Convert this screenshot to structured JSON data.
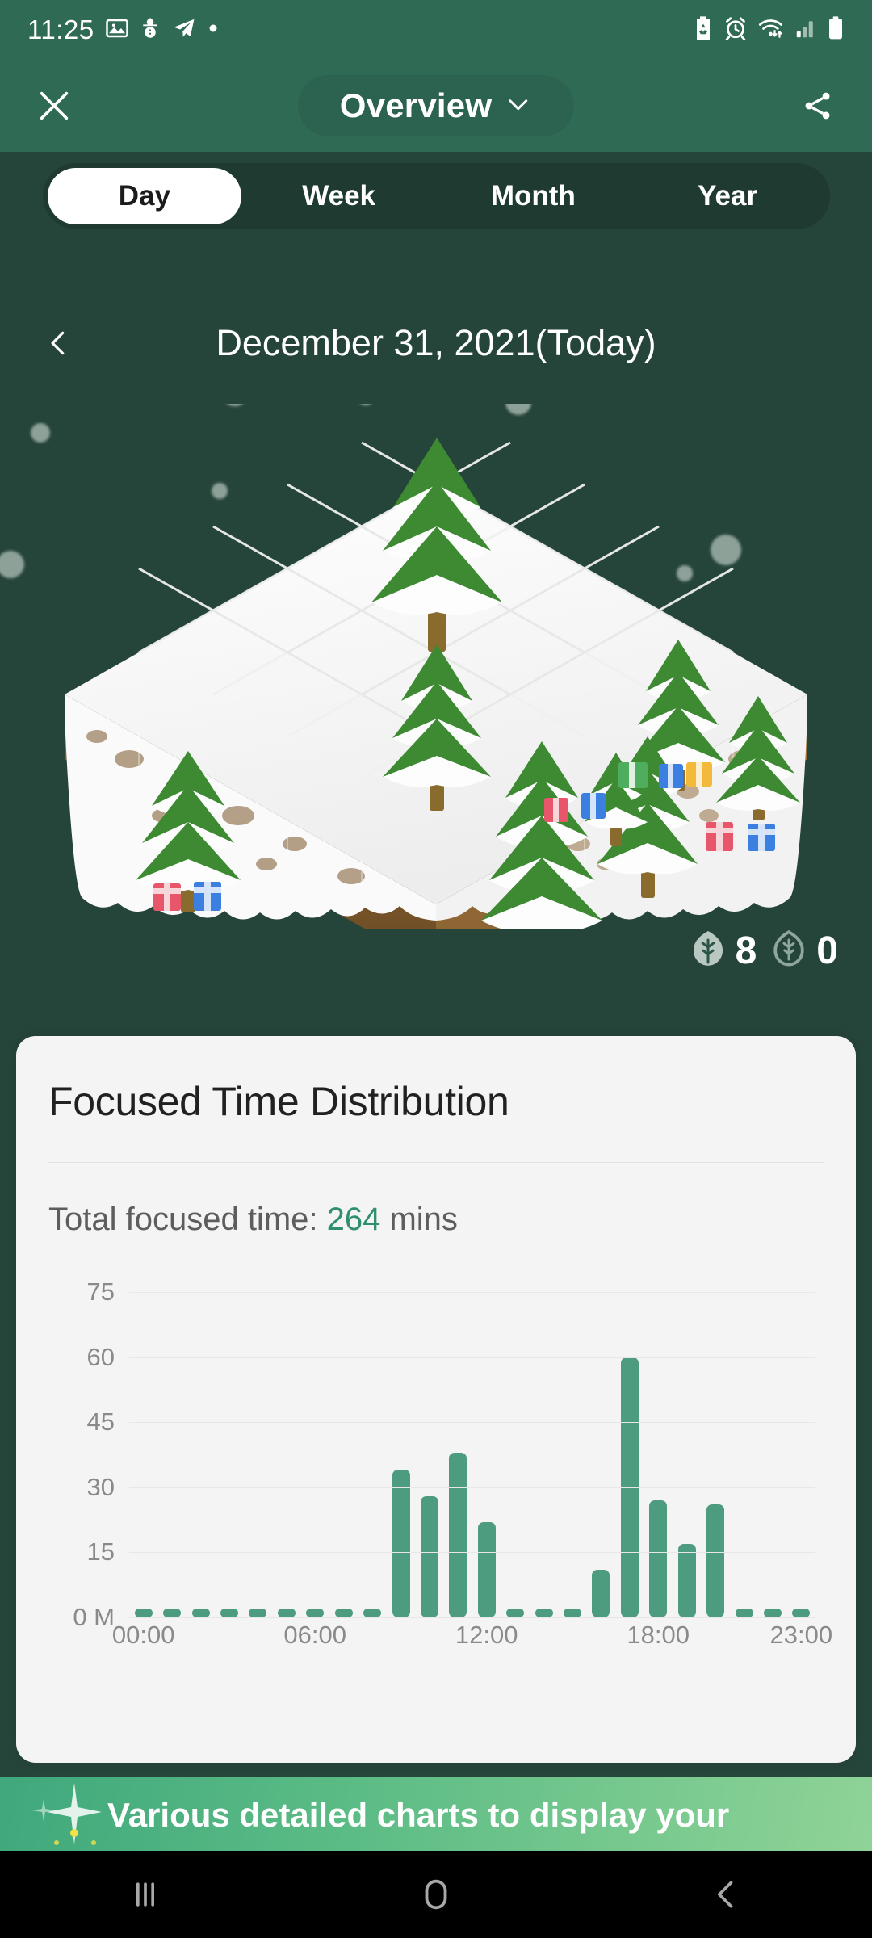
{
  "status_bar": {
    "time": "11:25",
    "left_icons": [
      "gallery-icon",
      "snowman-icon",
      "telegram-icon",
      "dot-icon"
    ],
    "right_icons": [
      "power-saving-icon",
      "alarm-icon",
      "wifi-icon",
      "signal-icon",
      "battery-icon"
    ]
  },
  "app_bar": {
    "close_label": "✕",
    "title": "Overview",
    "dropdown_icon": "chevron-down-icon",
    "share_icon": "share-icon"
  },
  "tabs": {
    "items": [
      {
        "label": "Day",
        "active": true
      },
      {
        "label": "Week",
        "active": false
      },
      {
        "label": "Month",
        "active": false
      },
      {
        "label": "Year",
        "active": false
      }
    ]
  },
  "date_nav": {
    "prev_icon": "chevron-left-icon",
    "label": "December 31, 2021(Today)"
  },
  "forest": {
    "healthy_trees": "8",
    "dead_trees": "0",
    "healthy_icon": "leaf-filled-icon",
    "dead_icon": "leaf-outline-icon",
    "scene_description": "isometric snow island with pine trees and gift boxes"
  },
  "chart_card": {
    "title": "Focused Time Distribution",
    "total_prefix": "Total focused time: ",
    "total_value": "264",
    "total_suffix": " mins",
    "accent_color": "#2F8F6E"
  },
  "chart_data": {
    "type": "bar",
    "title": "Focused Time Distribution",
    "xlabel": "",
    "ylabel": "M",
    "ylim": [
      0,
      80
    ],
    "grid": true,
    "legend": "none",
    "bar_color": "#4E9C7F",
    "categories": [
      "00:00",
      "01:00",
      "02:00",
      "03:00",
      "04:00",
      "05:00",
      "06:00",
      "07:00",
      "08:00",
      "09:00",
      "10:00",
      "11:00",
      "12:00",
      "13:00",
      "14:00",
      "15:00",
      "16:00",
      "17:00",
      "18:00",
      "19:00",
      "20:00",
      "21:00",
      "22:00",
      "23:00"
    ],
    "values": [
      0,
      0,
      0,
      0,
      0,
      0,
      0,
      0,
      0,
      34,
      28,
      38,
      22,
      0,
      0,
      0,
      11,
      60,
      27,
      17,
      26,
      0,
      0,
      0
    ],
    "ytick_labels": [
      "75",
      "60",
      "45",
      "30",
      "15",
      "0 M"
    ],
    "ytick_values": [
      75,
      60,
      45,
      30,
      15,
      0
    ],
    "xtick_labels": [
      "00:00",
      "06:00",
      "12:00",
      "18:00",
      "23:00"
    ],
    "xtick_indices": [
      0,
      6,
      12,
      18,
      23
    ]
  },
  "promo": {
    "text": "Various detailed charts to display your"
  },
  "nav_bar": {
    "recents_icon": "recents-icon",
    "home_icon": "home-icon",
    "back_icon": "back-icon"
  },
  "colors": {
    "status_green": "#2F6B54",
    "body_green": "#26453A",
    "tab_track": "#1F3B31",
    "card_bg": "#F4F4F4",
    "bar_green": "#4E9C7F"
  }
}
